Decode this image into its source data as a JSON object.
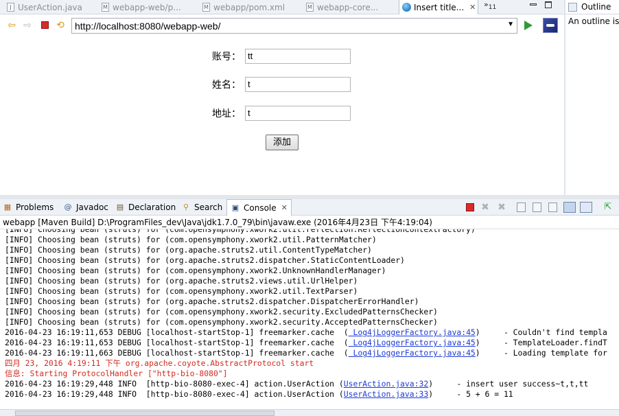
{
  "editor_tabs": [
    {
      "label": "UserAction.java",
      "icon": "java-file-icon"
    },
    {
      "label": "webapp-web/p...",
      "icon": "maven-file-icon"
    },
    {
      "label": "webapp/pom.xml",
      "icon": "maven-file-icon"
    },
    {
      "label": "webapp-core...",
      "icon": "maven-file-icon"
    },
    {
      "label": "Insert title...",
      "icon": "globe-icon",
      "active": true
    }
  ],
  "tab_overflow": {
    "glyph": "»",
    "count": "11"
  },
  "browser": {
    "url": "http://localhost:8080/webapp-web/"
  },
  "form": {
    "fields": [
      {
        "label": "账号：",
        "value": "tt"
      },
      {
        "label": "姓名：",
        "value": "t"
      },
      {
        "label": "地址：",
        "value": "t"
      }
    ],
    "submit_label": "添加"
  },
  "outline": {
    "title": "Outline",
    "message": "An outline is"
  },
  "view_tabs": [
    {
      "label": "Problems",
      "icon": "problems-icon"
    },
    {
      "label": "Javadoc",
      "icon": "javadoc-icon"
    },
    {
      "label": "Declaration",
      "icon": "declaration-icon"
    },
    {
      "label": "Search",
      "icon": "search-icon"
    },
    {
      "label": "Console",
      "icon": "console-icon",
      "active": true
    }
  ],
  "console": {
    "process_label": "webapp [Maven Build] D:\\ProgramFiles_dev\\Java\\jdk1.7.0_79\\bin\\javaw.exe (2016年4月23日 下午4:19:04)",
    "lines": [
      {
        "text": "[INFO] Choosing bean (struts) for (com.opensymphony.xwork2.util.reflection.ReflectionContextFactory)"
      },
      {
        "text": "[INFO] Choosing bean (struts) for (com.opensymphony.xwork2.util.PatternMatcher)"
      },
      {
        "text": "[INFO] Choosing bean (struts) for (org.apache.struts2.util.ContentTypeMatcher)"
      },
      {
        "text": "[INFO] Choosing bean (struts) for (org.apache.struts2.dispatcher.StaticContentLoader)"
      },
      {
        "text": "[INFO] Choosing bean (struts) for (com.opensymphony.xwork2.UnknownHandlerManager)"
      },
      {
        "text": "[INFO] Choosing bean (struts) for (org.apache.struts2.views.util.UrlHelper)"
      },
      {
        "text": "[INFO] Choosing bean (struts) for (com.opensymphony.xwork2.util.TextParser)"
      },
      {
        "text": "[INFO] Choosing bean (struts) for (org.apache.struts2.dispatcher.DispatcherErrorHandler)"
      },
      {
        "text": "[INFO] Choosing bean (struts) for (com.opensymphony.xwork2.security.ExcludedPatternsChecker)"
      },
      {
        "text": "[INFO] Choosing bean (struts) for (com.opensymphony.xwork2.security.AcceptedPatternsChecker)"
      },
      {
        "pre": "2016-04-23 16:19:11,653 DEBUG [localhost-startStop-1] freemarker.cache  (",
        "link": " Log4jLoggerFactory.java:45",
        "post": ")     - Couldn't find templa"
      },
      {
        "pre": "2016-04-23 16:19:11,653 DEBUG [localhost-startStop-1] freemarker.cache  (",
        "link": " Log4jLoggerFactory.java:45",
        "post": ")     - TemplateLoader.findT"
      },
      {
        "pre": "2016-04-23 16:19:11,663 DEBUG [localhost-startStop-1] freemarker.cache  (",
        "link": " Log4jLoggerFactory.java:45",
        "post": ")     - Loading template for"
      },
      {
        "text": "四月 23, 2016 4:19:11 下午 org.apache.coyote.AbstractProtocol start",
        "red": true
      },
      {
        "text": "信息: Starting ProtocolHandler [\"http-bio-8080\"]",
        "red": true
      },
      {
        "pre": "2016-04-23 16:19:29,448 INFO  [http-bio-8080-exec-4] action.UserAction (",
        "link": "UserAction.java:32",
        "post": ")     - insert user success~t,t,tt"
      },
      {
        "pre": "2016-04-23 16:19:29,448 INFO  [http-bio-8080-exec-4] action.UserAction (",
        "link": "UserAction.java:33",
        "post": ")     - 5 + 6 = 11"
      }
    ]
  },
  "colors": {
    "error_text": "#d22b1f",
    "link": "#1c3ad4",
    "tab_bar": "#eef2f7"
  }
}
